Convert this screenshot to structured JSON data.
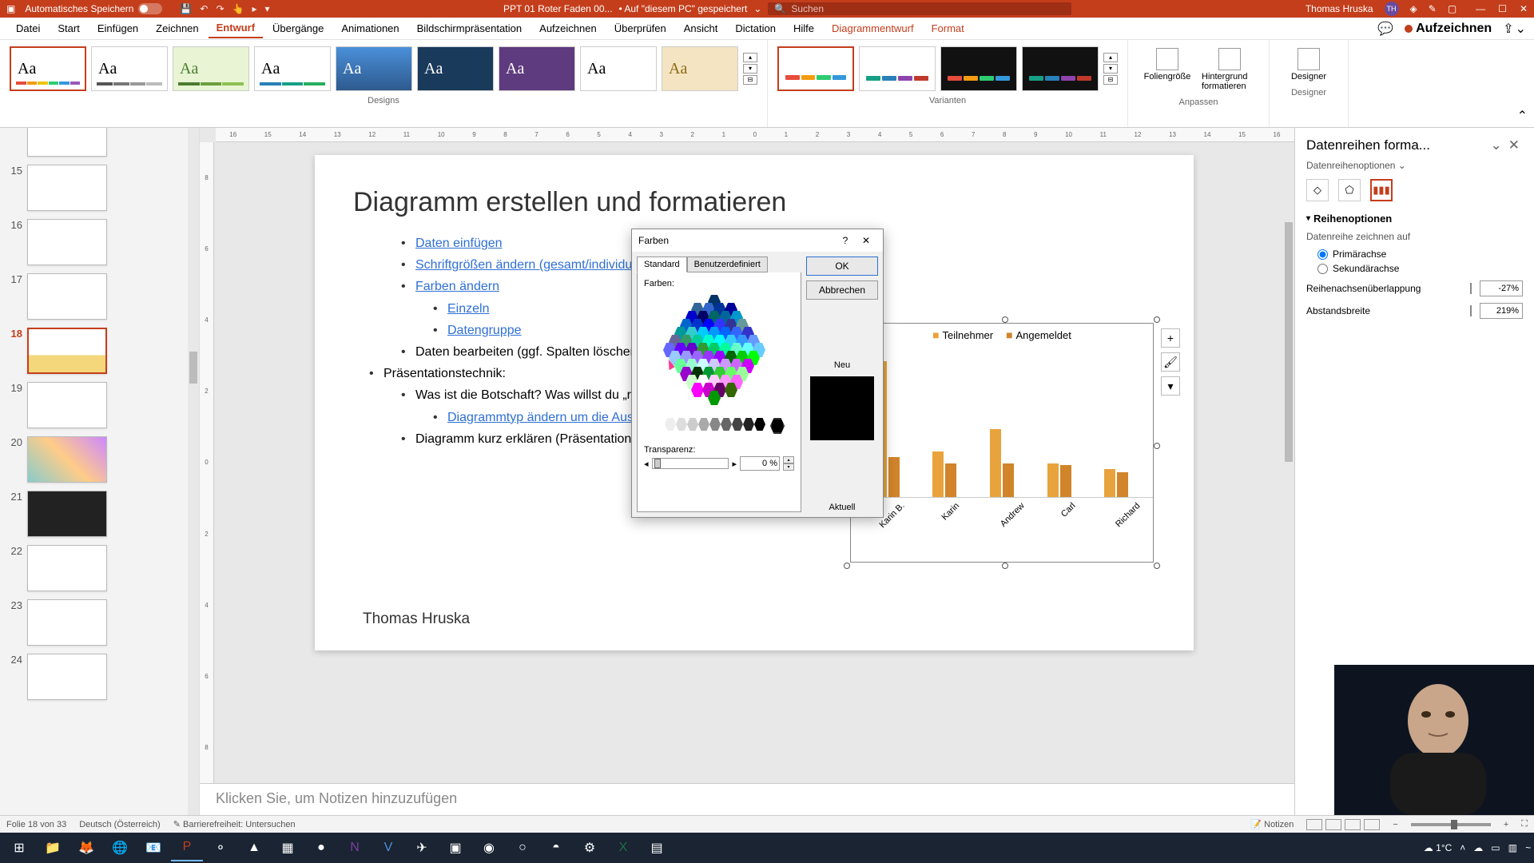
{
  "titlebar": {
    "autosave": "Automatisches Speichern",
    "filename": "PPT 01 Roter Faden 00...",
    "saved": "• Auf \"diesem PC\" gespeichert",
    "search_placeholder": "Suchen",
    "username": "Thomas Hruska",
    "initials": "TH"
  },
  "tabs": {
    "datei": "Datei",
    "start": "Start",
    "einfuegen": "Einfügen",
    "zeichnen": "Zeichnen",
    "entwurf": "Entwurf",
    "uebergaenge": "Übergänge",
    "animationen": "Animationen",
    "bildschirm": "Bildschirmpräsentation",
    "aufzeichnen": "Aufzeichnen",
    "ueberpruefen": "Überprüfen",
    "ansicht": "Ansicht",
    "dictation": "Dictation",
    "hilfe": "Hilfe",
    "diagrammentwurf": "Diagrammentwurf",
    "format": "Format",
    "aufzeichnen_btn": "Aufzeichnen"
  },
  "ribbon": {
    "designs": "Designs",
    "varianten": "Varianten",
    "anpassen": "Anpassen",
    "designer": "Designer",
    "foliengroesse": "Foliengröße",
    "hintergrund": "Hintergrund formatieren",
    "designer_btn": "Designer"
  },
  "thumbnails": [
    {
      "num": "15"
    },
    {
      "num": "16"
    },
    {
      "num": "17"
    },
    {
      "num": "18"
    },
    {
      "num": "19"
    },
    {
      "num": "20"
    },
    {
      "num": "21"
    },
    {
      "num": "22"
    },
    {
      "num": "23"
    },
    {
      "num": "24"
    }
  ],
  "slide": {
    "title": "Diagramm erstellen und formatieren",
    "items": [
      {
        "lvl": 1,
        "text": "Daten einfügen",
        "link": true
      },
      {
        "lvl": 1,
        "text": "Schriftgrößen ändern (gesamt/individuell)",
        "link": true
      },
      {
        "lvl": 1,
        "text": "Farben ändern",
        "link": true
      },
      {
        "lvl": 2,
        "text": "Einzeln",
        "link": true
      },
      {
        "lvl": 2,
        "text": "Datengruppe",
        "link": true
      },
      {
        "lvl": 1,
        "text": "Daten bearbeiten (ggf. Spalten löschen)",
        "link": false
      },
      {
        "lvl": 0,
        "text": "Präsentationstechnik:",
        "link": false
      },
      {
        "lvl": 1,
        "text": "Was ist die Botschaft? Was willst du „rüberbringen\"",
        "link": false
      },
      {
        "lvl": 2,
        "text": "Diagrammtyp ändern um die Aussage zu verbessern",
        "link": true
      },
      {
        "lvl": 1,
        "text": "Diagramm kurz erklären (Präsentationstechnik)",
        "link": false
      }
    ],
    "author": "Thomas Hruska"
  },
  "chart_data": {
    "type": "bar",
    "series": [
      {
        "name": "Teilnehmer",
        "values": [
          120,
          40,
          60,
          30,
          25
        ]
      },
      {
        "name": "Angemeldet",
        "values": [
          35,
          30,
          30,
          28,
          22
        ]
      }
    ],
    "categories": [
      "Karin B.",
      "Karin",
      "Andrew",
      "Carl",
      "Richard"
    ],
    "colors": [
      "#e8a33d",
      "#d1842a"
    ]
  },
  "chart_tools": {
    "plus": "+",
    "brush": "🖌",
    "filter": "▾"
  },
  "dialog": {
    "title": "Farben",
    "help": "?",
    "tab_standard": "Standard",
    "tab_custom": "Benutzerdefiniert",
    "colors_label": "Farben:",
    "ok": "OK",
    "cancel": "Abbrechen",
    "transparency": "Transparenz:",
    "trans_value": "0 %",
    "new": "Neu",
    "current": "Aktuell"
  },
  "sidepane": {
    "title": "Datenreihen forma...",
    "sub": "Datenreihenoptionen",
    "section": "Reihenoptionen",
    "draw_on": "Datenreihe zeichnen auf",
    "primary": "Primärachse",
    "secondary": "Sekundärachse",
    "overlap": "Reihenachsenüberlappung",
    "overlap_val": "-27%",
    "gap": "Abstandsbreite",
    "gap_val": "219%"
  },
  "notes": "Klicken Sie, um Notizen hinzuzufügen",
  "statusbar": {
    "slide": "Folie 18 von 33",
    "lang": "Deutsch (Österreich)",
    "access": "Barrierefreiheit: Untersuchen",
    "notizen": "Notizen"
  },
  "taskbar": {
    "weather": "1°C",
    "time": ""
  }
}
